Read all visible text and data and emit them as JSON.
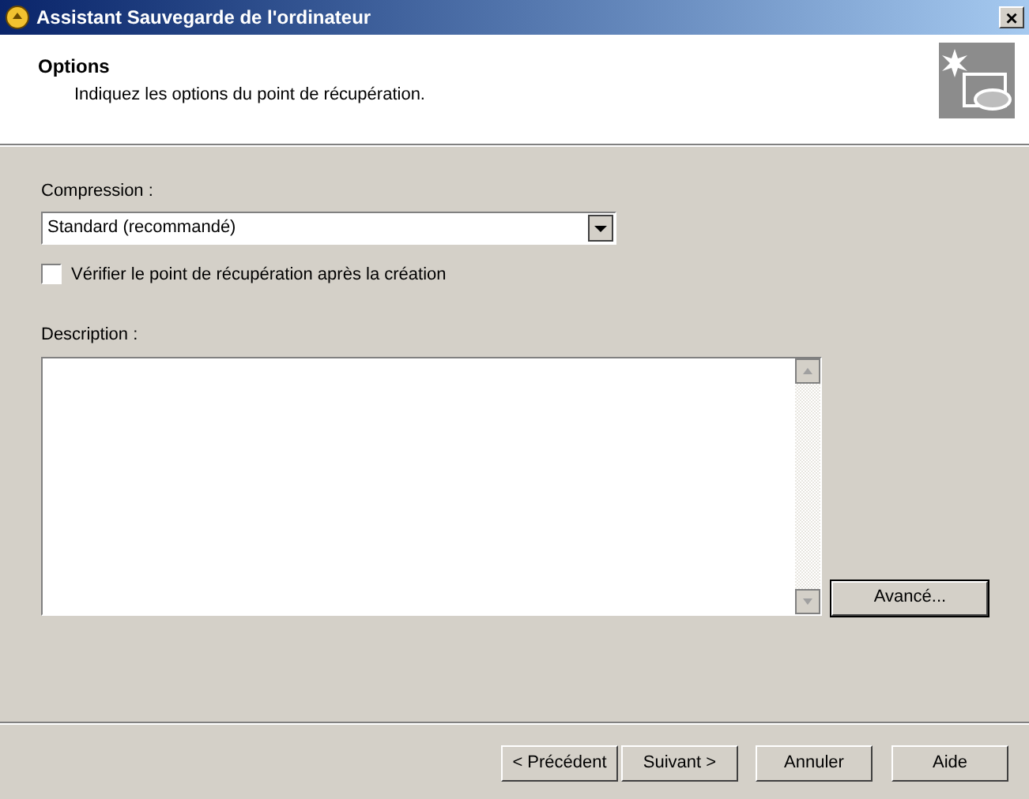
{
  "window": {
    "title": "Assistant Sauvegarde de l'ordinateur",
    "close": "×"
  },
  "header": {
    "title": "Options",
    "subtitle": "Indiquez les options du point de récupération."
  },
  "compression": {
    "label": "Compression :",
    "value": "Standard (recommandé)"
  },
  "verify": {
    "label": "Vérifier le point de récupération après la création",
    "checked": false
  },
  "description": {
    "label": "Description :"
  },
  "advanced_button": "Avancé...",
  "buttons": [
    {
      "label": "< Précédent",
      "default": false
    },
    {
      "label": "Suivant >",
      "default": false
    },
    {
      "label": "Annuler",
      "default": false
    },
    {
      "label": "Aide",
      "default": false
    }
  ]
}
